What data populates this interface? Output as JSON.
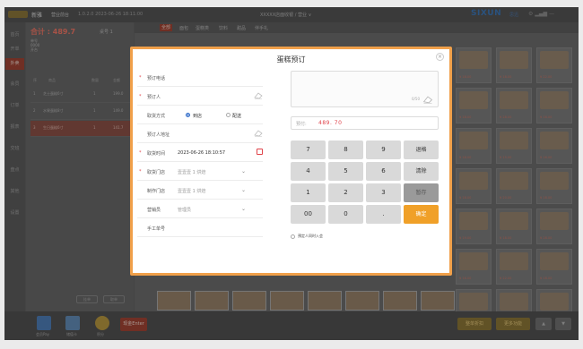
{
  "topbar": {
    "app_name": "新雅",
    "sub_name": "营业前台",
    "device": "1.0.2.0  2023-06-26  18:11:00",
    "store": "XXXXX店面收银 / 营业 ∨",
    "brand": "SIXUN",
    "brand_cn": "思迅"
  },
  "leftnav": {
    "items": [
      "首页",
      "开单",
      "外卖",
      "会员",
      "订单",
      "报表",
      "交班",
      "盘点",
      "其他",
      "设置"
    ],
    "active_index": 2
  },
  "order": {
    "total_label": "合计 :",
    "total": "489.7",
    "table_no": "桌号 1",
    "meta": [
      "单号",
      "0000",
      "开台"
    ],
    "head": [
      "序",
      "商品",
      "数量",
      "金额"
    ],
    "rows": [
      {
        "no": "1",
        "name": "芝士蛋糕6寸",
        "qty": "1",
        "amount": "199.0"
      },
      {
        "no": "2",
        "name": "水果蛋糕8寸",
        "qty": "1",
        "amount": "149.0"
      },
      {
        "no": "3",
        "name": "生日蛋糕6寸",
        "qty": "1",
        "amount": "141.7"
      }
    ],
    "buttons": [
      "挂单",
      "取单"
    ]
  },
  "content": {
    "tabs": [
      "全部",
      "面包",
      "蛋糕类",
      "饮料",
      "甜品",
      "伴手礼"
    ],
    "tile_prices": [
      "¥ 18.00",
      "¥ 18.00",
      "¥ 22.00",
      "¥ 18.00",
      "¥ 28.00",
      "¥ 16.00",
      "¥ 18.00",
      "¥ 15.00",
      "¥ 16.00",
      "¥ 18.00",
      "¥ 20.00",
      "¥ 18.00",
      "¥ 19.00",
      "¥ 18.00",
      "¥ 28.00",
      "¥ 16.00",
      "¥ 22.00",
      "¥ 18.00",
      "¥ 15.00",
      "¥ 16.00",
      "¥ 18.00"
    ]
  },
  "bottombar": {
    "labels": [
      "会员Pay",
      "储值卡",
      "积分"
    ],
    "red_btn": "现金Enter",
    "right_btn_1": "整单折扣",
    "right_btn_2": "更多功能"
  },
  "modal": {
    "title": "蛋糕预订",
    "close": "×",
    "form": {
      "phone_label": "预订电话",
      "person_label": "预订人",
      "method_label": "取货方式",
      "method_options": [
        "到店",
        "配送"
      ],
      "address_label": "预订人地址",
      "time_label": "取货时间",
      "time_value": "2023-06-26 18:10:57",
      "pickup_store_label": "取货门店",
      "pickup_store_value": "壹壹壹 1 烘焙",
      "make_store_label": "制作门店",
      "make_store_value": "壹壹壹 1 烘焙",
      "sales_label": "营销员",
      "sales_value": "管理员",
      "manual_no_label": "手工单号"
    },
    "note_count": "0/50",
    "amount_label": "预付:",
    "amount": "489. 70",
    "keys": [
      "7",
      "8",
      "9",
      "退格",
      "4",
      "5",
      "6",
      "清除",
      "1",
      "2",
      "3",
      "暂存",
      "00",
      "0",
      ".",
      "确定"
    ],
    "checkbox_label": "预定人同时入会"
  }
}
